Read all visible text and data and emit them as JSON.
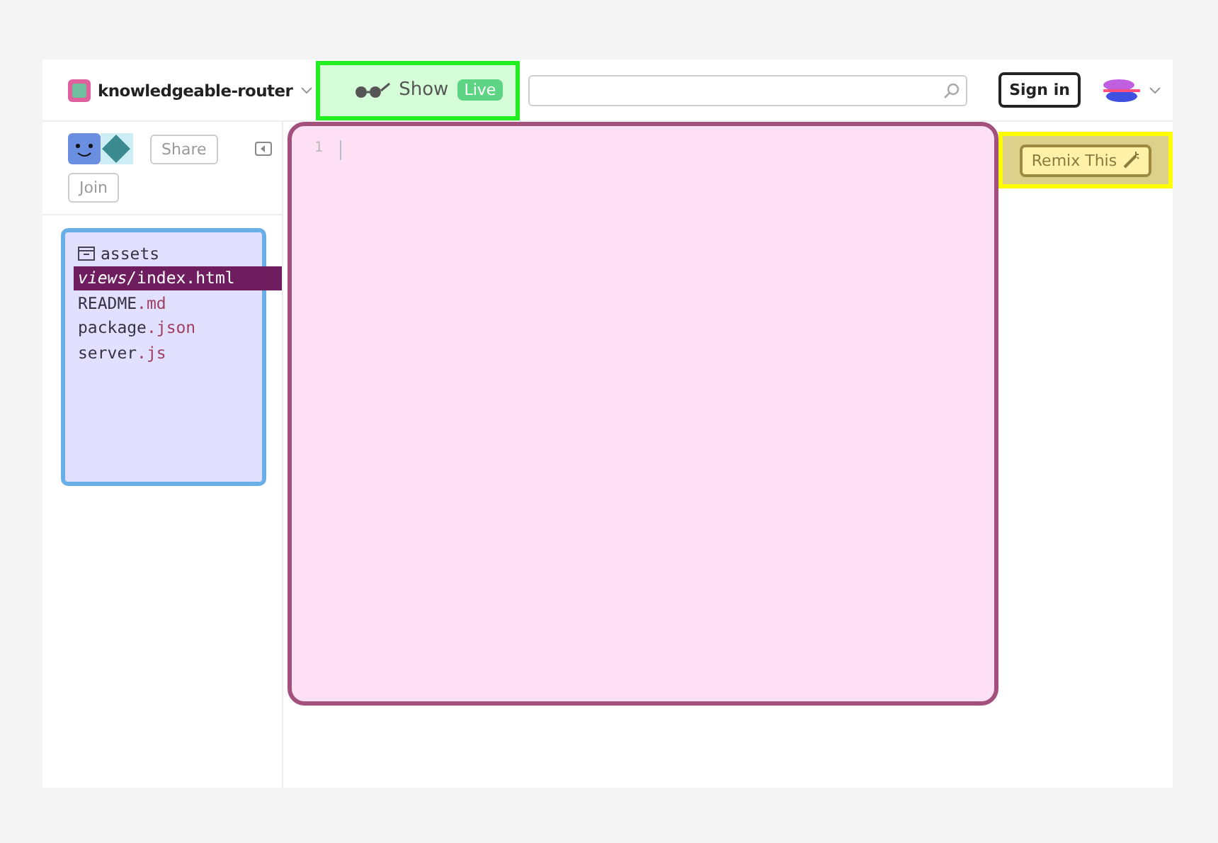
{
  "header": {
    "project_name": "knowledgeable-router",
    "show_button": {
      "label": "Show",
      "badge": "Live"
    },
    "sign_in": "Sign in"
  },
  "sidebar": {
    "share": "Share",
    "join": "Join"
  },
  "files": [
    {
      "name": "assets",
      "kind": "folder",
      "selected": false
    },
    {
      "dir": "views/",
      "name": "index",
      "ext": ".html",
      "kind": "file",
      "selected": true
    },
    {
      "name": "README",
      "ext": ".md",
      "kind": "file",
      "selected": false
    },
    {
      "name": "package",
      "ext": ".json",
      "kind": "file",
      "selected": false
    },
    {
      "name": "server",
      "ext": ".js",
      "kind": "file",
      "selected": false
    }
  ],
  "editor": {
    "line_numbers": [
      "1"
    ]
  },
  "remix_button": "Remix This"
}
